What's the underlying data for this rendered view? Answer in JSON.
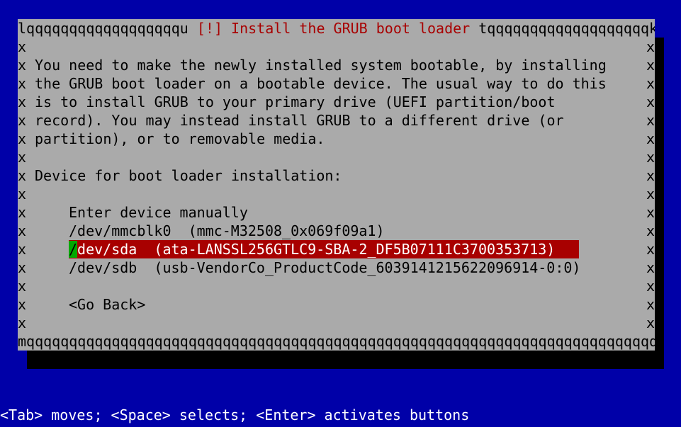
{
  "dialog": {
    "title": "[!] Install the GRUB boot loader",
    "title_left_border": "lqqqqqqqqqqqqqqqqqqu ",
    "title_right_border": " tqqqqqqqqqqqqqqqqqqqk",
    "bottom_border": "mqqqqqqqqqqqqqqqqqqqqqqqqqqqqqqqqqqqqqqqqqqqqqqqqqqqqqqqqqqqqqqqqqqqqqqqqqqqqqqqqqqqqqqqqqqqqqqj",
    "side_char": "x",
    "description_lines": [
      "You need to make the newly installed system bootable, by installing",
      "the GRUB boot loader on a bootable device. The usual way to do this",
      "is to install GRUB to your primary drive (UEFI partition/boot",
      "record). You may instead install GRUB to a different drive (or",
      "partition), or to removable media."
    ],
    "prompt": "Device for boot loader installation:",
    "options": [
      "Enter device manually",
      "/dev/mmcblk0  (mmc-M32508_0x069f09a1)",
      "/dev/sda  (ata-LANSSL256GTLC9-SBA-2_DF5B07111C3700353713)",
      "/dev/sdb  (usb-VendorCo_ProductCode_6039141215622096914-0:0)"
    ],
    "selected_option_cursor": "/",
    "selected_option_rest": "dev/sda  (ata-LANSSL256GTLC9-SBA-2_DF5B07111C3700353713)",
    "go_back": "<Go Back>"
  },
  "footer": {
    "help": "<Tab> moves; <Space> selects; <Enter> activates buttons"
  },
  "colors": {
    "background": "#0000a8",
    "dialog": "#aaaaaa",
    "title": "#a80000",
    "selection": "#a80000",
    "cursor": "#00a800"
  }
}
